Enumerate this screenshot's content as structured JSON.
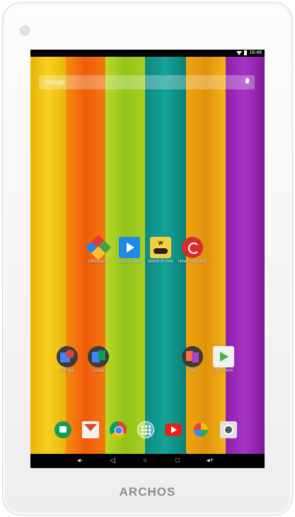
{
  "brand": "ARCHOS",
  "status": {
    "time": "16:48"
  },
  "search": {
    "label": "Google"
  },
  "apps": [
    {
      "label": "OfficeSuite"
    },
    {
      "label": "Archos Video"
    },
    {
      "label": "World of Goo"
    },
    {
      "label": "News Republic"
    },
    {
      "label": "Google"
    },
    {
      "label": "Create"
    },
    {
      "label": "Play"
    },
    {
      "label": "Play Store"
    }
  ],
  "dock": [
    "hangouts-icon",
    "gmail-icon",
    "chrome-icon",
    "app-drawer-icon",
    "youtube-icon",
    "photos-icon",
    "camera-icon"
  ],
  "colors": {
    "yellow": "#f2c00f",
    "orange": "#f06a0a",
    "lime": "#9fca1e",
    "teal": "#0f8f85",
    "amber": "#e9a10f",
    "purple": "#9a28b7"
  }
}
